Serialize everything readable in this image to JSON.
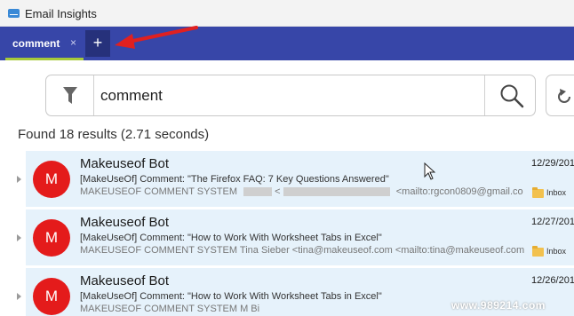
{
  "window": {
    "title": "Email Insights"
  },
  "tabs": [
    {
      "label": "comment",
      "close_glyph": "×"
    }
  ],
  "add_tab": {
    "label": "+"
  },
  "search": {
    "value": "comment"
  },
  "results": {
    "summary": "Found 18 results (2.71 seconds)",
    "items": [
      {
        "avatar_letter": "M",
        "sender": "Makeuseof Bot",
        "subject": "[MakeUseOf] Comment: \"The Firefox FAQ: 7 Key Questions Answered\"",
        "from_name": "MAKEUSEOF COMMENT SYSTEM",
        "from_lt": "<",
        "from_mailto": "<mailto:rgcon0809@gmail.co",
        "date": "12/29/201",
        "folder": "Inbox"
      },
      {
        "avatar_letter": "M",
        "sender": "Makeuseof Bot",
        "subject": "[MakeUseOf] Comment: \"How to Work With Worksheet Tabs in Excel\"",
        "from_line": "MAKEUSEOF COMMENT SYSTEM Tina Sieber <tina@makeuseof.com  <mailto:tina@makeuseof.com",
        "date": "12/27/201",
        "folder": "Inbox"
      },
      {
        "avatar_letter": "M",
        "sender": "Makeuseof Bot",
        "subject": "[MakeUseOf] Comment: \"How to Work With Worksheet Tabs in Excel\"",
        "from_line": "MAKEUSEOF COMMENT SYSTEM M Bi",
        "date": "12/26/201",
        "folder": ""
      }
    ]
  },
  "watermark": "www.989214.com",
  "colors": {
    "tabbar": "#3746a8",
    "add_tab": "#26317b",
    "tab_underline": "#a6c93a",
    "row_bg": "#e6f2fb",
    "avatar": "#e41b1b",
    "arrow": "#e02020"
  }
}
